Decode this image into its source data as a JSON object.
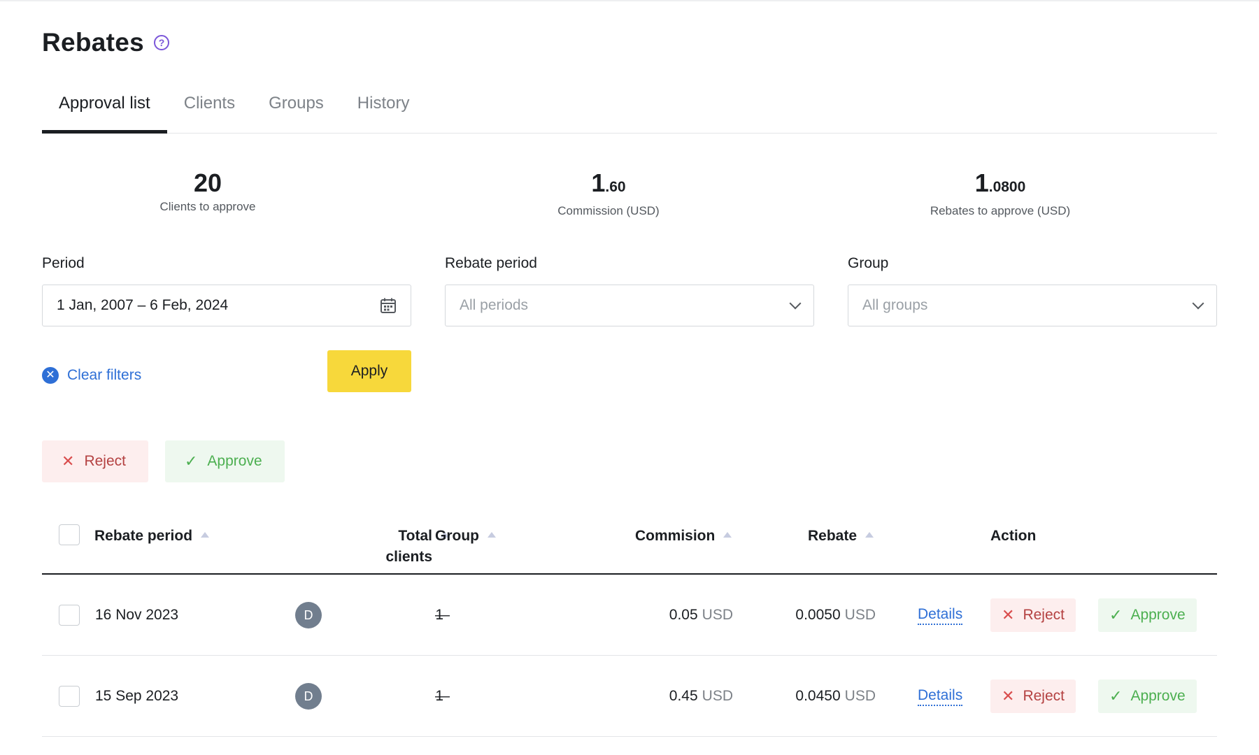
{
  "page": {
    "title": "Rebates"
  },
  "tabs": [
    {
      "label": "Approval list",
      "active": true
    },
    {
      "label": "Clients",
      "active": false
    },
    {
      "label": "Groups",
      "active": false
    },
    {
      "label": "History",
      "active": false
    }
  ],
  "stats": {
    "clients": {
      "value": "20",
      "label": "Clients to approve"
    },
    "commission": {
      "int": "1",
      "dec": ".60",
      "label": "Commission (USD)"
    },
    "rebates": {
      "int": "1",
      "dec": ".0800",
      "label": "Rebates to approve (USD)"
    }
  },
  "filters": {
    "period": {
      "label": "Period",
      "value": "1 Jan, 2007 – 6 Feb, 2024"
    },
    "rebate_period": {
      "label": "Rebate period",
      "placeholder": "All periods"
    },
    "group": {
      "label": "Group",
      "placeholder": "All groups"
    },
    "clear_label": "Clear filters",
    "apply_label": "Apply"
  },
  "bulk": {
    "reject_label": "Reject",
    "approve_label": "Approve"
  },
  "table": {
    "headers": {
      "rebate_period": "Rebate period",
      "total_clients_1": "Total",
      "total_clients_2": "clients",
      "group": "Group",
      "commission": "Commision",
      "rebate": "Rebate",
      "action": "Action"
    },
    "rows": [
      {
        "period": "16 Nov 2023",
        "avatar": "D",
        "total_clients": "1",
        "group": "—",
        "commission_value": "0.05",
        "commission_currency": "USD",
        "rebate_value": "0.0050",
        "rebate_currency": "USD",
        "details_label": "Details",
        "reject_label": "Reject",
        "approve_label": "Approve"
      },
      {
        "period": "15 Sep 2023",
        "avatar": "D",
        "total_clients": "1",
        "group": "—",
        "commission_value": "0.45",
        "commission_currency": "USD",
        "rebate_value": "0.0450",
        "rebate_currency": "USD",
        "details_label": "Details",
        "reject_label": "Reject",
        "approve_label": "Approve"
      }
    ]
  },
  "icons": {
    "help": "help-circle-icon",
    "calendar": "calendar-icon",
    "chevron": "chevron-down-icon",
    "clear": "clear-circle-icon",
    "reject": "x-icon",
    "approve": "check-icon",
    "sort": "sort-up-icon"
  },
  "colors": {
    "accent_yellow": "#f7d83b",
    "link_blue": "#2e6fd6",
    "reject_red": "#b44141",
    "approve_green": "#4caf50",
    "help_purple": "#7b56d9"
  }
}
